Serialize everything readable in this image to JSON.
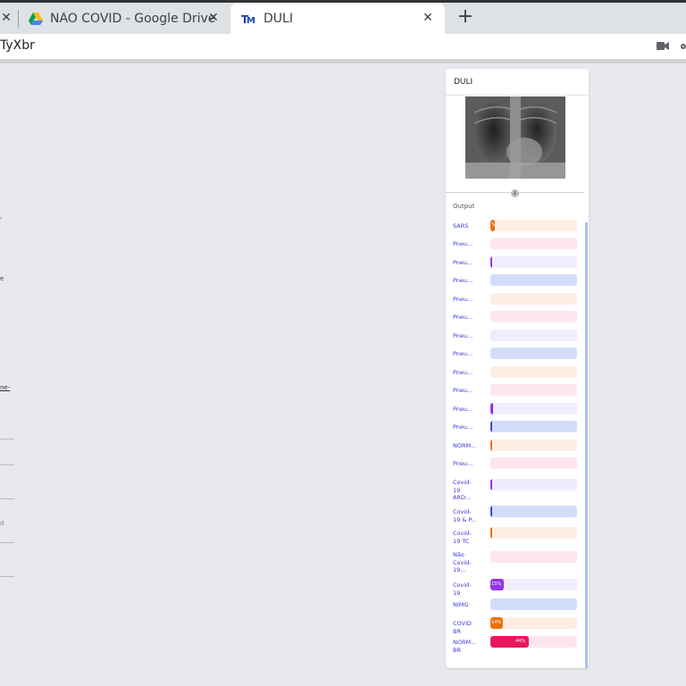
{
  "tabs": [
    {
      "title": ""
    },
    {
      "title": "NÃO COVID - Google Drive"
    },
    {
      "title": "DULI"
    }
  ],
  "url": "TyXbr",
  "left_snippets": [
    ",",
    "e",
    "ne-",
    "d"
  ],
  "panel": {
    "title": "DULI",
    "output_label": "Output"
  },
  "colors": {
    "orange": "#e8710a",
    "pink": "#e8175d",
    "purple": "#9334e6",
    "blue": "#3b4bd1",
    "orange_bg": "#fdeee4",
    "pink_bg": "#fde7ec",
    "purple_bg": "#f1ecfb",
    "blue_bg": "#d3ddfa"
  },
  "predictions": [
    {
      "label": "SARS",
      "value": 0.05,
      "color": "orange",
      "pct_text": "%"
    },
    {
      "label": "Pneu...",
      "value": 0.0,
      "color": "pink",
      "pct_text": ""
    },
    {
      "label": "Pneu...",
      "value": 0.02,
      "color": "purple",
      "pct_text": ""
    },
    {
      "label": "Pneu...",
      "value": 0.0,
      "color": "blue",
      "pct_text": ""
    },
    {
      "label": "Pneu...",
      "value": 0.0,
      "color": "orange",
      "pct_text": ""
    },
    {
      "label": "Pneu...",
      "value": 0.0,
      "color": "pink",
      "pct_text": ""
    },
    {
      "label": "Pneu...",
      "value": 0.0,
      "color": "purple",
      "pct_text": ""
    },
    {
      "label": "Pneu...",
      "value": 0.0,
      "color": "blue",
      "pct_text": ""
    },
    {
      "label": "Pneu...",
      "value": 0.0,
      "color": "orange",
      "pct_text": ""
    },
    {
      "label": "Pneu...",
      "value": 0.0,
      "color": "pink",
      "pct_text": ""
    },
    {
      "label": "Pneu...",
      "value": 0.03,
      "color": "purple",
      "pct_text": ""
    },
    {
      "label": "Pneu...",
      "value": 0.01,
      "color": "blue",
      "pct_text": ""
    },
    {
      "label": "NORM...",
      "value": 0.01,
      "color": "orange",
      "pct_text": ""
    },
    {
      "label": "Pneu...",
      "value": 0.0,
      "color": "pink",
      "pct_text": ""
    },
    {
      "label": "Covid-19 ARD...",
      "value": 0.02,
      "color": "purple",
      "pct_text": ""
    },
    {
      "label": "Covid-19 & P...",
      "value": 0.02,
      "color": "blue",
      "pct_text": ""
    },
    {
      "label": "Covid-19 TC",
      "value": 0.02,
      "color": "orange",
      "pct_text": ""
    },
    {
      "label": "Não Covid-19...",
      "value": 0.0,
      "color": "pink",
      "pct_text": ""
    },
    {
      "label": "Covid-19",
      "value": 0.15,
      "color": "purple",
      "pct_text": "15%"
    },
    {
      "label": "NIMG",
      "value": 0.0,
      "color": "blue",
      "pct_text": ""
    },
    {
      "label": "COVID BR",
      "value": 0.14,
      "color": "orange",
      "pct_text": "14%"
    },
    {
      "label": "NORM... BR",
      "value": 0.44,
      "color": "pink",
      "pct_text": "44%"
    }
  ]
}
